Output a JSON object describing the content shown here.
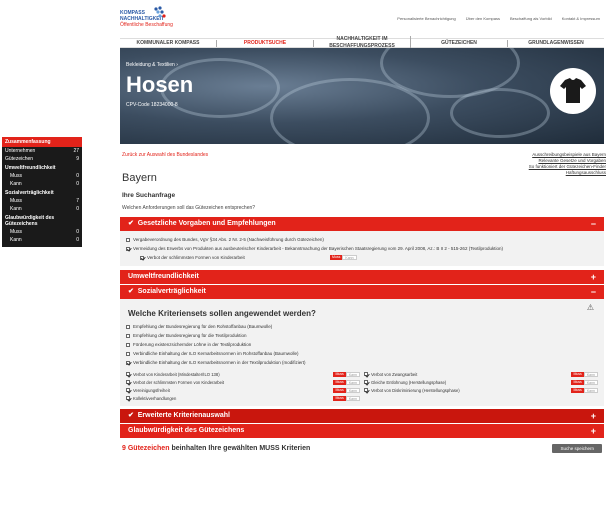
{
  "summary": {
    "heading": "Zusammenfassung",
    "unternehmen_label": "Unternehmen",
    "unternehmen_count": "27",
    "guetezeichen_label": "Gütezeichen",
    "guetezeichen_count": "9",
    "umwelt_label": "Umweltfreundlichkeit",
    "umwelt_muss_label": "Muss",
    "umwelt_muss": "0",
    "umwelt_kann_label": "Kann",
    "umwelt_kann": "0",
    "sozial_label": "Sozialverträglichkeit",
    "sozial_muss_label": "Muss",
    "sozial_muss": "7",
    "sozial_kann_label": "Kann",
    "sozial_kann": "0",
    "glaub_label": "Glaubwürdigkeit des Gütezeichens",
    "glaub_muss_label": "Muss",
    "glaub_muss": "0",
    "glaub_kann_label": "Kann",
    "glaub_kann": "0"
  },
  "brand": {
    "line1": "KOMPASS",
    "line2": "NACHHALTIGKEIT",
    "line3": "Öffentliche Beschaffung"
  },
  "toplinks": [
    "Personalisierte Benachrichtigung",
    "Über den Kompass",
    "Beschaffung als Vorbild",
    "Kontakt & Impressum"
  ],
  "nav": [
    "KOMMUNALER KOMPASS",
    "PRODUKTSUCHE",
    "NACHHALTIGKEIT IM BESCHAFFUNGSPROZESS",
    "GÜTEZEICHEN",
    "GRUNDLAGENWISSEN"
  ],
  "hero": {
    "crumb": "Bekleidung & Textilien  ›",
    "title": "Hosen",
    "cpv": "CPV-Code 18234000-8"
  },
  "back_link": "Zurück zur Auswahl des Bundeslandes",
  "right_links": [
    "Ausschreibungsbeispiele aus Bayern",
    "Relevante Gesetze und Vorgaben",
    "So funktioniert der Gütezeichen-Finder",
    "Haftungsausschluss"
  ],
  "state": "Bayern",
  "suche_heading": "Ihre Suchanfrage",
  "question": "Welchen Anforderungen soll das Gütezeichen entsprechen?",
  "section_gesetz": "Gesetzliche Vorgaben und Empfehlungen",
  "gesetz_items": [
    "Vergabeverordnung des Bundes, VgV §34 Abs. 2 Nr. 2-5 (Nachweisführung durch Gütezeichen)",
    "Vermeidung des Erwerbs von Produkten aus ausbeuterischer Kinderarbeit - Bekanntmachung der Bayerischen Staatsregierung vom 29. April 2008, Az.: B II 2 - 515-262 (Textilproduktion)"
  ],
  "gesetz_sub": "Verbot der schlimmsten Formen von Kinderarbeit",
  "muss_label": "Muss",
  "kann_label": "Kann",
  "section_umwelt": "Umweltfreundlichkeit",
  "section_sozial": "Sozialverträglichkeit",
  "kriterien_question": "Welche Kriteriensets sollen angewendet werden?",
  "kriterien": [
    "Empfehlung der Bundesregierung für den Rohstoffanbau (Baumwolle)",
    "Empfehlung der Bundesregierung für die Textilproduktion",
    "Förderung existenzsichernder Löhne in der Textilproduktion",
    "Verbindliche Einhaltung der ILO Kernarbeitsnormen im Rohstoffanbau (Baumwolle)",
    "Verbindliche Einhaltung der ILO Kernarbeitsnormen in der Textilproduktion (modifiziert)"
  ],
  "ilo_left": [
    "Verbot von Kinderarbeit (Mindestalter/ILO 138)",
    "Verbot der schlimmsten Formen von Kinderarbeit",
    "Vereinigungsfreiheit",
    "Kollektivverhandlungen"
  ],
  "ilo_right": [
    "Verbot von Zwangsarbeit",
    "Gleiche Entlohnung (Herstellungsphase)",
    "Verbot von Diskriminierung (Herstellungsphase)"
  ],
  "section_erweitert": "Erweiterte Kriterienauswahl",
  "section_glaub": "Glaubwürdigkeit des Gütezeichens",
  "result_count": "9",
  "result_word": "Gütezeichen",
  "result_text": "beinhalten Ihre gewählten MUSS Kriterien",
  "save_button": "Suche speichern",
  "colors": {
    "accent": "#e2231a",
    "dark": "#1a1a1a"
  }
}
